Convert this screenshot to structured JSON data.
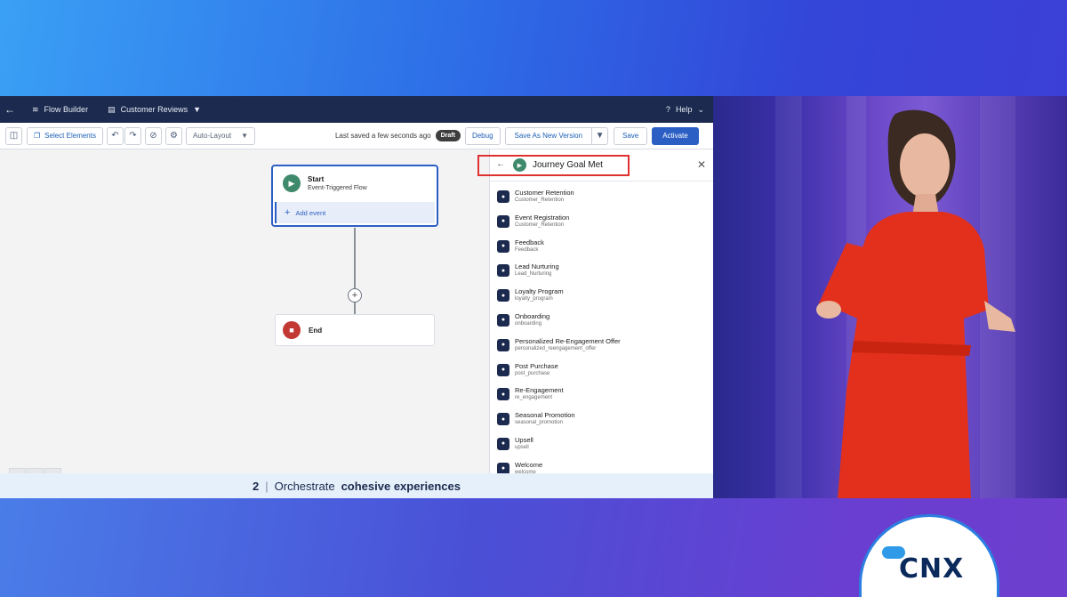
{
  "app": {
    "name": "Flow Builder",
    "document": "Customer Reviews",
    "help": "Help"
  },
  "toolbar": {
    "select_elements": "Select Elements",
    "layout": "Auto-Layout",
    "status": "Last saved a few seconds ago",
    "draft": "Draft",
    "debug": "Debug",
    "save_as": "Save As New Version",
    "save": "Save",
    "activate": "Activate"
  },
  "canvas": {
    "start_title": "Start",
    "start_subtitle": "Event-Triggered Flow",
    "add_event": "Add event",
    "end_title": "End"
  },
  "panel": {
    "title": "Journey Goal Met",
    "items": [
      {
        "label": "Customer Retention",
        "api": "Customer_Retention"
      },
      {
        "label": "Event Registration",
        "api": "Customer_Retention"
      },
      {
        "label": "Feedback",
        "api": "Feedback"
      },
      {
        "label": "Lead Nurturing",
        "api": "Lead_Nurturing"
      },
      {
        "label": "Loyalty Program",
        "api": "loyalty_program"
      },
      {
        "label": "Onboarding",
        "api": "onboarding"
      },
      {
        "label": "Personalized Re-Engagement Offer",
        "api": "personalized_reengagement_offer"
      },
      {
        "label": "Post Purchase",
        "api": "post_purchase"
      },
      {
        "label": "Re-Engagement",
        "api": "re_engagement"
      },
      {
        "label": "Seasonal Promotion",
        "api": "seasonal_promotion"
      },
      {
        "label": "Upsell",
        "api": "upsell"
      },
      {
        "label": "Welcome",
        "api": "welcome"
      }
    ]
  },
  "caption": {
    "number": "2",
    "separator": "|",
    "lead": "Orchestrate",
    "emphasis": "cohesive experiences"
  },
  "event_logo": "CNX",
  "colors": {
    "header_bg": "#1b2a4e",
    "accent": "#2c5fc4",
    "highlight": "#e03030",
    "start_icon": "#3f8a6c",
    "end_icon": "#c23934"
  }
}
